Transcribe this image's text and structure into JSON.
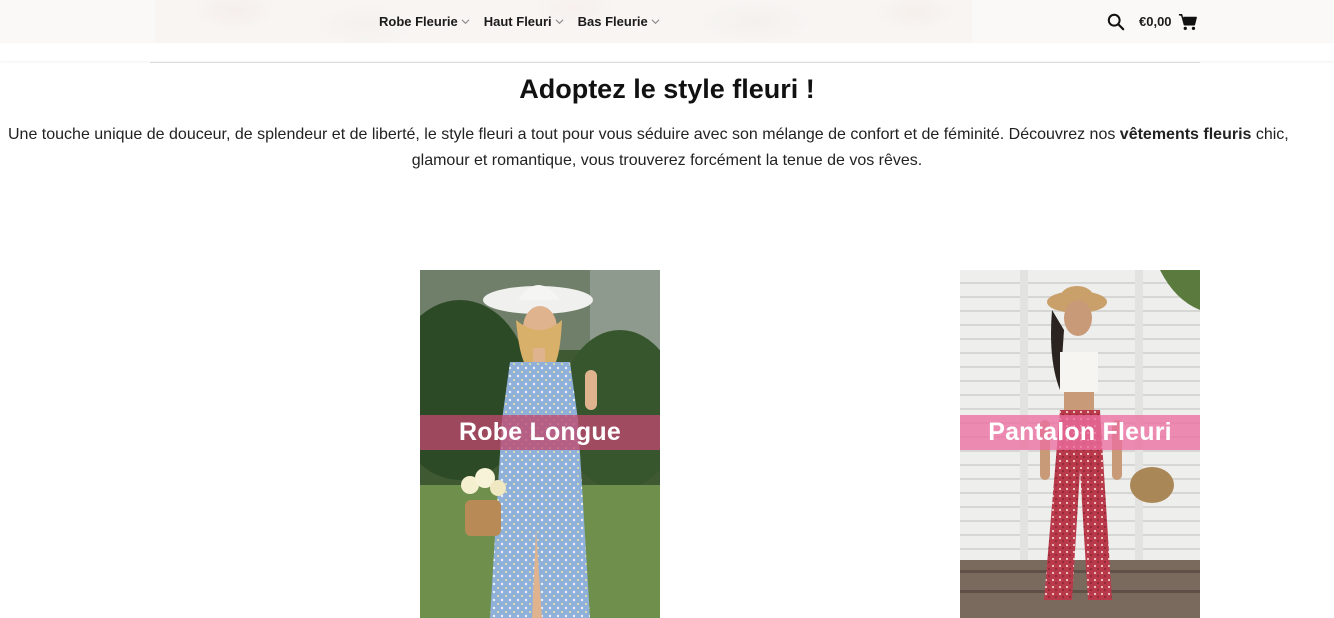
{
  "header": {
    "nav": [
      {
        "label": "Robe Fleurie"
      },
      {
        "label": "Haut Fleuri"
      },
      {
        "label": "Bas Fleurie"
      }
    ],
    "cart_total": "€0,00"
  },
  "hero": {
    "title": "Adoptez le style fleuri !",
    "intro_part1": "Une touche unique de douceur, de splendeur et de liberté, le style fleuri a tout pour vous séduire avec son mélange de confort et de féminité. Découvrez nos ",
    "intro_bold": "vêtements fleuris",
    "intro_part2": " chic,",
    "intro_line2": "glamour et romantique, vous trouverez forcément la tenue de vos rêves."
  },
  "categories": [
    {
      "label": "Robe Longue"
    },
    {
      "label": "Pantalon Fleuri"
    }
  ],
  "colors": {
    "band_left": "#be486e",
    "band_right": "#ec6ea0"
  }
}
